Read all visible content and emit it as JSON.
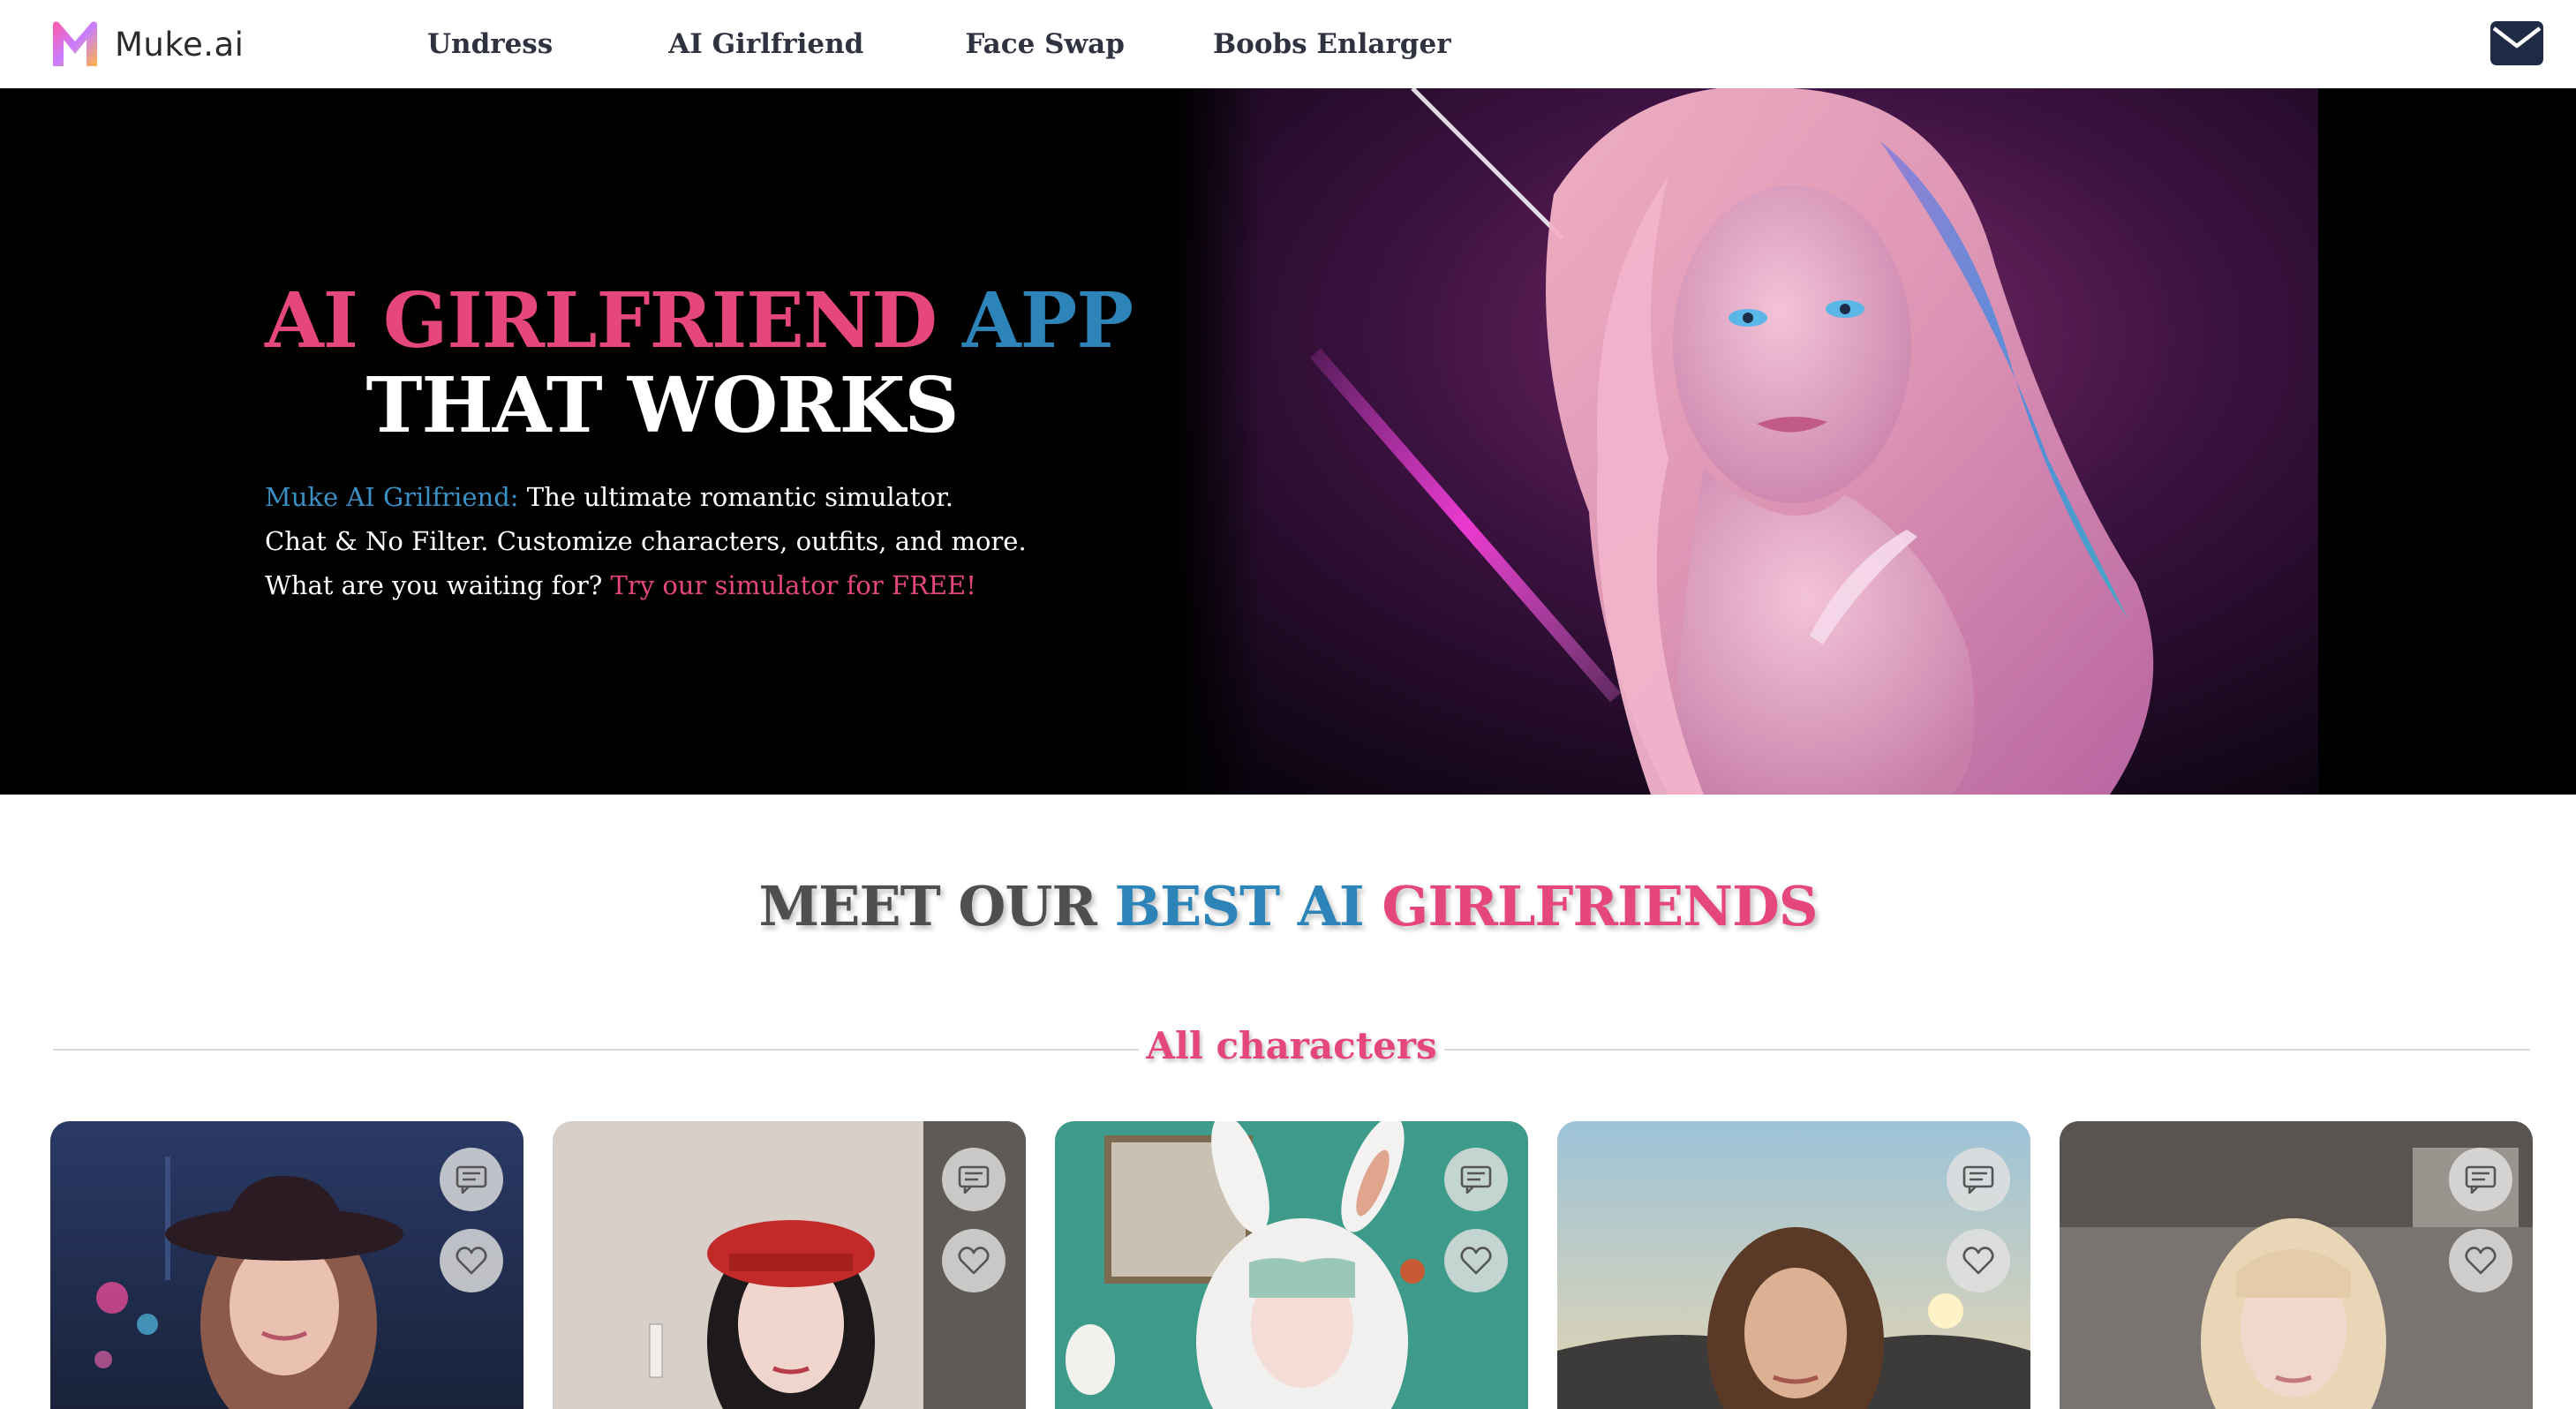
{
  "brand": {
    "name": "Muke.ai",
    "logo_icon": "muke-m-logo-icon"
  },
  "nav": {
    "items": [
      {
        "label": "Undress"
      },
      {
        "label": "AI Girlfriend"
      },
      {
        "label": "Face Swap"
      },
      {
        "label": "Boobs Enlarger"
      }
    ],
    "mail_icon": "envelope-icon"
  },
  "hero": {
    "title_part1": "AI GIRLFRIEND ",
    "title_part2": "APP",
    "title_line2": "THAT WORKS",
    "desc": {
      "brand_label": "Muke AI Grilfriend:",
      "line1_rest": " The ultimate romantic simulator.",
      "line2": "Chat & No Filter. Customize characters, outfits, and more.",
      "line3_start": "What are you waiting for? ",
      "cta": "Try our simulator for FREE!"
    },
    "image": "neon-lit-portrait-woman"
  },
  "section": {
    "title_part1": "MEET OUR ",
    "title_part2": "BEST AI ",
    "title_part3": "GIRLFRIENDS",
    "filter_label": "All characters"
  },
  "cards": [
    {
      "image": "woman-black-hat-city-night"
    },
    {
      "image": "woman-red-beret"
    },
    {
      "image": "girl-bunny-hood-costume"
    },
    {
      "image": "woman-beach-sunset"
    },
    {
      "image": "blonde-woman-bangs"
    }
  ],
  "card_icons": {
    "chat": "chat-bubble-icon",
    "like": "heart-icon"
  },
  "colors": {
    "accent_pink": "#e6477a",
    "accent_blue": "#2d84b8",
    "nav_text": "#2f3340",
    "hero_bg": "#000000"
  }
}
